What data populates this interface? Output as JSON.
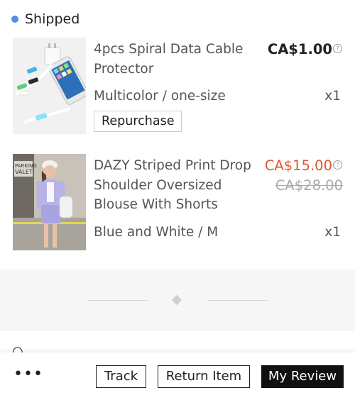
{
  "status": {
    "label": "Shipped",
    "color": "#4a90e2"
  },
  "items": [
    {
      "title": "4pcs Spiral Data Cable Protector",
      "price": "CA$1.00",
      "variant": "Multicolor / one-size",
      "quantity": "x1",
      "repurchase_label": "Repurchase",
      "image_icon": "cable-protector-thumbnail"
    },
    {
      "title": "DAZY Striped Print Drop Shoulder Oversized Blouse With Shorts",
      "price": "CA$15.00",
      "original_price": "CA$28.00",
      "variant": "Blue and White / M",
      "quantity": "x1",
      "price_color": "#e0562d",
      "image_icon": "outfit-photo-thumbnail"
    }
  ],
  "info_icon": "?",
  "more_menu": "•••",
  "actions": {
    "track": "Track",
    "return_item": "Return Item",
    "my_review": "My Review"
  }
}
